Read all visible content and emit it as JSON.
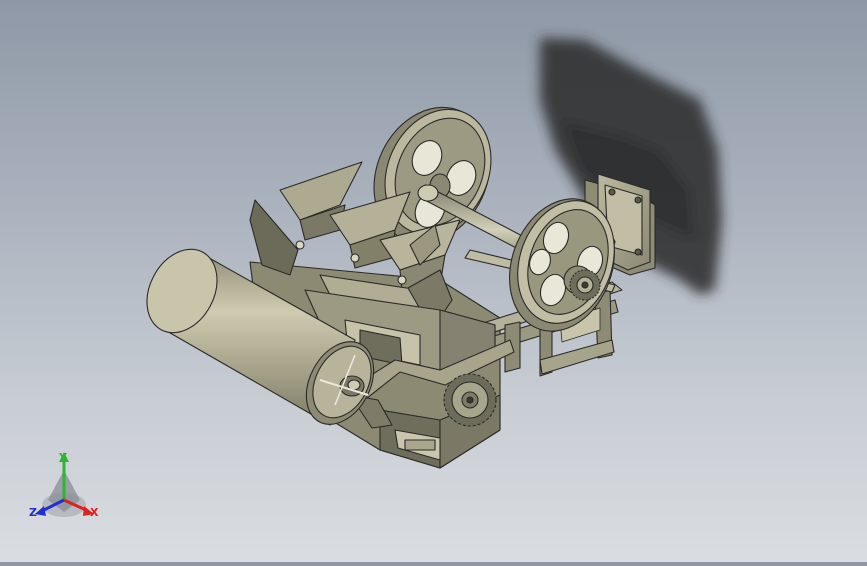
{
  "triad": {
    "x_label": "X",
    "y_label": "Y",
    "z_label": "Z",
    "x_color": "#e0201e",
    "y_color": "#2fb52f",
    "z_color": "#1f2fd0"
  },
  "model": {
    "body_color": "#a3a087",
    "edge_color": "#2a2a28",
    "shadow_color": "#2e2e2e"
  }
}
